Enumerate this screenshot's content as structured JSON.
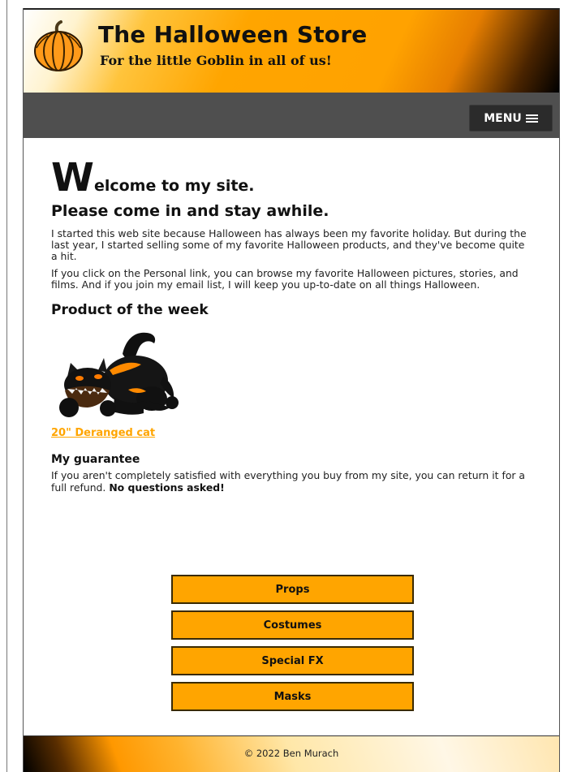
{
  "header": {
    "title": "The Halloween Store",
    "subtitle": "For the little Goblin in all of us!",
    "logo_icon": "pumpkin-icon"
  },
  "nav": {
    "menu_label": "MENU",
    "menu_icon": "hamburger-icon"
  },
  "main": {
    "welcome_first_letter": "W",
    "welcome_rest": "elcome to my site.",
    "welcome_sub": "Please come in and stay awhile.",
    "paragraph_1": "I started this web site because Halloween has always been my favorite holiday. But during the last year, I started selling some of my favorite Halloween products, and they've become quite a hit.",
    "paragraph_2": "If you click on the Personal link, you can browse my favorite Halloween pictures, stories, and films. And if you join my email list, I will keep you up-to-date on all things Halloween.",
    "product_heading": "Product of the week",
    "product_image_icon": "black-cat-image",
    "product_link": "20\" Deranged cat",
    "guarantee_heading": "My guarantee",
    "guarantee_text": "If you aren't completely satisfied with everything you buy from my site, you can return it for a full refund.",
    "guarantee_emphasis": "No questions asked!"
  },
  "category_buttons": [
    "Props",
    "Costumes",
    "Special FX",
    "Masks"
  ],
  "footer": {
    "copyright": "© 2022 Ben Murach"
  },
  "colors": {
    "accent_orange": "#ffa500",
    "nav_gray": "#4f4f4f",
    "menu_button": "#2b2b2b"
  }
}
